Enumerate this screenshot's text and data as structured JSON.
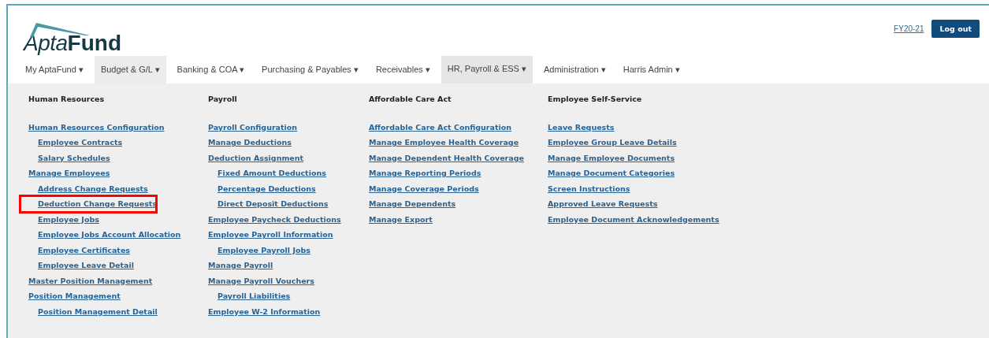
{
  "logo": {
    "light": "Apta",
    "bold": "Fund"
  },
  "header": {
    "fiscal_year_link": "FY20-21",
    "logout_button": "Log out"
  },
  "nav": [
    {
      "label": "My AptaFund ▾",
      "selected": false,
      "hovered": false
    },
    {
      "label": "Budget & G/L ▾",
      "selected": false,
      "hovered": true
    },
    {
      "label": "Banking & COA ▾",
      "selected": false,
      "hovered": false
    },
    {
      "label": "Purchasing & Payables ▾",
      "selected": false,
      "hovered": false
    },
    {
      "label": "Receivables ▾",
      "selected": false,
      "hovered": false
    },
    {
      "label": "HR, Payroll & ESS ▾",
      "selected": true,
      "hovered": false
    },
    {
      "label": "Administration ▾",
      "selected": false,
      "hovered": false
    },
    {
      "label": "Harris Admin ▾",
      "selected": false,
      "hovered": false
    }
  ],
  "menu_columns": [
    {
      "heading": "Human Resources",
      "items": [
        {
          "label": "Human Resources Configuration",
          "highlighted": false,
          "children": [
            {
              "label": "Employee Contracts",
              "highlighted": false
            },
            {
              "label": "Salary Schedules",
              "highlighted": false
            }
          ]
        },
        {
          "label": "Manage Employees",
          "highlighted": false,
          "children": [
            {
              "label": "Address Change Requests",
              "highlighted": false
            },
            {
              "label": "Deduction Change Requests",
              "highlighted": true
            },
            {
              "label": "Employee Jobs",
              "highlighted": false
            },
            {
              "label": "Employee Jobs Account Allocation",
              "highlighted": false
            },
            {
              "label": "Employee Certificates",
              "highlighted": false
            },
            {
              "label": "Employee Leave Detail",
              "highlighted": false
            }
          ]
        },
        {
          "label": "Master Position Management",
          "highlighted": false
        },
        {
          "label": "Position Management",
          "highlighted": false,
          "children": [
            {
              "label": "Position Management Detail",
              "highlighted": false
            }
          ]
        }
      ]
    },
    {
      "heading": "Payroll",
      "items": [
        {
          "label": "Payroll Configuration",
          "highlighted": false
        },
        {
          "label": "Manage Deductions",
          "highlighted": false
        },
        {
          "label": "Deduction Assignment",
          "highlighted": false,
          "children": [
            {
              "label": "Fixed Amount Deductions",
              "highlighted": false
            },
            {
              "label": "Percentage Deductions",
              "highlighted": false
            },
            {
              "label": "Direct Deposit Deductions",
              "highlighted": false
            }
          ]
        },
        {
          "label": "Employee Paycheck Deductions",
          "highlighted": false
        },
        {
          "label": "Employee Payroll Information",
          "highlighted": false,
          "children": [
            {
              "label": "Employee Payroll Jobs",
              "highlighted": false
            }
          ]
        },
        {
          "label": "Manage Payroll",
          "highlighted": false
        },
        {
          "label": "Manage Payroll Vouchers",
          "highlighted": false,
          "children": [
            {
              "label": "Payroll Liabilities",
              "highlighted": false
            }
          ]
        },
        {
          "label": "Employee W-2 Information",
          "highlighted": false
        }
      ]
    },
    {
      "heading": "Affordable Care Act",
      "items": [
        {
          "label": "Affordable Care Act Configuration",
          "highlighted": false
        },
        {
          "label": "Manage Employee Health Coverage",
          "highlighted": false
        },
        {
          "label": "Manage Dependent Health Coverage",
          "highlighted": false
        },
        {
          "label": "Manage Reporting Periods",
          "highlighted": false
        },
        {
          "label": "Manage Coverage Periods",
          "highlighted": false
        },
        {
          "label": "Manage Dependents",
          "highlighted": false
        },
        {
          "label": "Manage Export",
          "highlighted": false
        }
      ]
    },
    {
      "heading": "Employee Self-Service",
      "items": [
        {
          "label": "Leave Requests",
          "highlighted": false
        },
        {
          "label": "Employee Group Leave Details",
          "highlighted": false
        },
        {
          "label": "Manage Employee Documents",
          "highlighted": false
        },
        {
          "label": "Manage Document Categories",
          "highlighted": false
        },
        {
          "label": "Screen Instructions",
          "highlighted": false
        },
        {
          "label": "Approved Leave Requests",
          "highlighted": false
        },
        {
          "label": "Employee Document Acknowledgements",
          "highlighted": false
        }
      ]
    }
  ]
}
